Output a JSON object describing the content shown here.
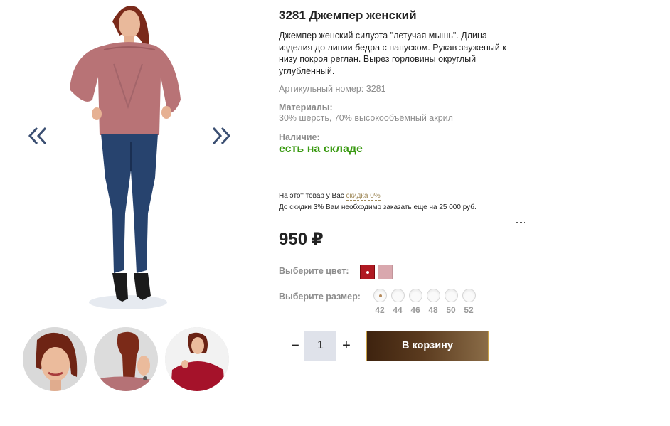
{
  "product": {
    "title": "3281 Джемпер женский",
    "description": "Джемпер женский силуэта \"летучая мышь\". Длина изделия до линии бедра с напуском. Рукав зауженый к низу покроя реглан. Вырез горловины округлый углублённый.",
    "sku": "Артикульный номер: 3281",
    "materials_label": "Материалы:",
    "materials_value": "30% шерсть, 70% высокообъёмный акрил",
    "availability_label": "Наличие:",
    "availability_value": "есть на складе",
    "availability_color": "#3a9a12"
  },
  "discount": {
    "line1_prefix": "На этот товар у Вас",
    "line1_link": "скидка 0%",
    "line2": "До скидки 3% Вам необходимо заказать еще на 25 000 руб."
  },
  "price": {
    "value": "950",
    "currency": "₽"
  },
  "color": {
    "label": "Выберите цвет:",
    "swatches": [
      {
        "hex": "#b01922",
        "selected": true
      },
      {
        "hex": "#d9a8ae",
        "selected": false
      }
    ]
  },
  "size": {
    "label": "Выберите размер:",
    "options": [
      "42",
      "44",
      "46",
      "48",
      "50",
      "52"
    ],
    "selected": "42"
  },
  "cart": {
    "quantity": "1",
    "minus": "−",
    "plus": "+",
    "button_label": "В корзину",
    "button_border": "#c9a24a"
  },
  "gallery": {
    "prev_icon": "chevron-double-left-icon",
    "next_icon": "chevron-double-right-icon",
    "thumbnails": 3
  }
}
